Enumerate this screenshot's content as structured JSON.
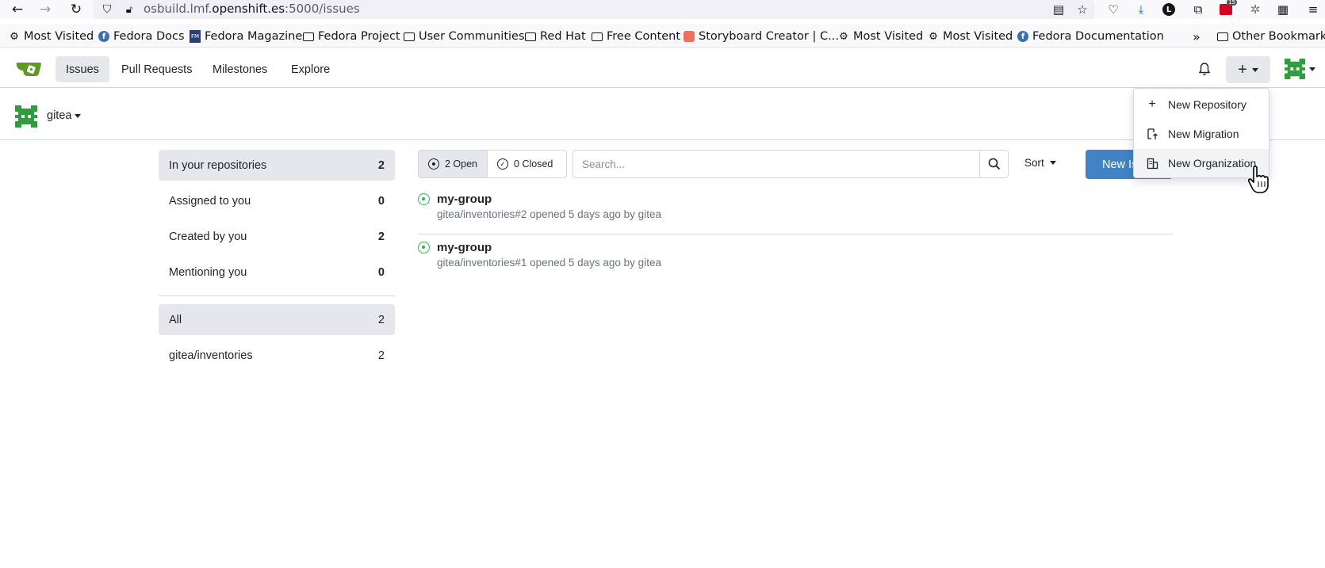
{
  "browser": {
    "url_prefix": "osbuild.lmf.",
    "url_domain": "openshift.es",
    "url_suffix": ":5000/issues",
    "bookmarks": [
      {
        "label": "Most Visited",
        "icon": "gear-icon"
      },
      {
        "label": "Fedora Docs",
        "icon": "fedora-icon"
      },
      {
        "label": "Fedora Magazine",
        "icon": "fedora-magazine-icon"
      },
      {
        "label": "Fedora Project",
        "icon": "folder-icon"
      },
      {
        "label": "User Communities",
        "icon": "folder-icon"
      },
      {
        "label": "Red Hat",
        "icon": "folder-icon"
      },
      {
        "label": "Free Content",
        "icon": "folder-icon"
      },
      {
        "label": "Storyboard Creator | C...",
        "icon": "storyboard-icon"
      },
      {
        "label": "Most Visited",
        "icon": "gear-icon"
      },
      {
        "label": "Most Visited",
        "icon": "gear-icon"
      },
      {
        "label": "Fedora Documentation",
        "icon": "fedora-icon"
      }
    ],
    "other_bookmarks": "Other Bookmarks",
    "badge_count": "15"
  },
  "navbar": {
    "items": [
      "Issues",
      "Pull Requests",
      "Milestones",
      "Explore"
    ],
    "active": "Issues"
  },
  "context": {
    "user": "gitea"
  },
  "sidebar": {
    "filters": [
      {
        "label": "In your repositories",
        "count": "2"
      },
      {
        "label": "Assigned to you",
        "count": "0"
      },
      {
        "label": "Created by you",
        "count": "2"
      },
      {
        "label": "Mentioning you",
        "count": "0"
      }
    ],
    "repos": [
      {
        "label": "All",
        "count": "2"
      },
      {
        "label": "gitea/inventories",
        "count": "2"
      }
    ]
  },
  "issues_toolbar": {
    "open_label": "2 Open",
    "closed_label": "0 Closed",
    "search_placeholder": "Search...",
    "sort_label": "Sort",
    "new_issue_label": "New Issue"
  },
  "issues": [
    {
      "title": "my-group",
      "meta": "gitea/inventories#2 opened 5 days ago by gitea"
    },
    {
      "title": "my-group",
      "meta": "gitea/inventories#1 opened 5 days ago by gitea"
    }
  ],
  "create_menu": {
    "items": [
      {
        "label": "New Repository",
        "icon": "plus-icon"
      },
      {
        "label": "New Migration",
        "icon": "repo-push-icon"
      },
      {
        "label": "New Organization",
        "icon": "organization-icon"
      }
    ]
  },
  "colors": {
    "accent": "#4183c4",
    "open_issue": "#21ba45",
    "gitea_green": "#609926"
  }
}
